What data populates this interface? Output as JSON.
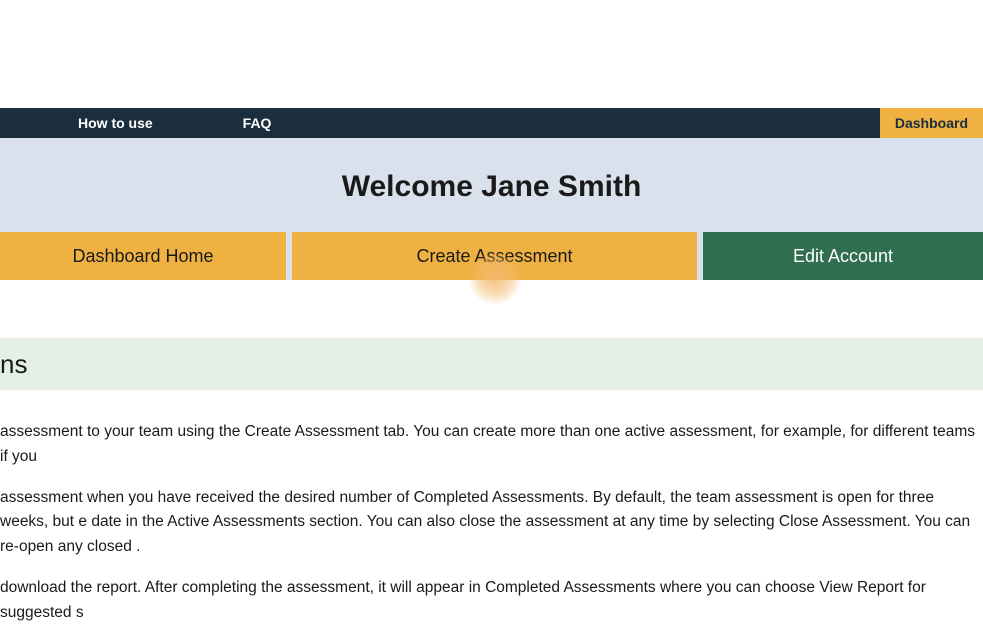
{
  "nav": {
    "how_to_use": "How to use",
    "faq": "FAQ",
    "dashboard": "Dashboard"
  },
  "welcome": {
    "title": "Welcome Jane Smith"
  },
  "tabs": {
    "dashboard_home": "Dashboard Home",
    "create_assessment": "Create Assessment",
    "edit_account": "Edit Account"
  },
  "section": {
    "title_fragment": "ns"
  },
  "body": {
    "p1": "assessment to your team using the Create Assessment tab. You can create more than one active assessment, for example, for different teams if you",
    "p2": "assessment when you have received the desired number of Completed Assessments. By default, the team assessment is open for three weeks, but e date in the Active Assessments section. You can also close the assessment at any time by selecting Close Assessment. You can re-open any closed .",
    "p3": "download the report. After completing the assessment, it will appear in Completed Assessments where you can choose View Report for suggested s"
  }
}
